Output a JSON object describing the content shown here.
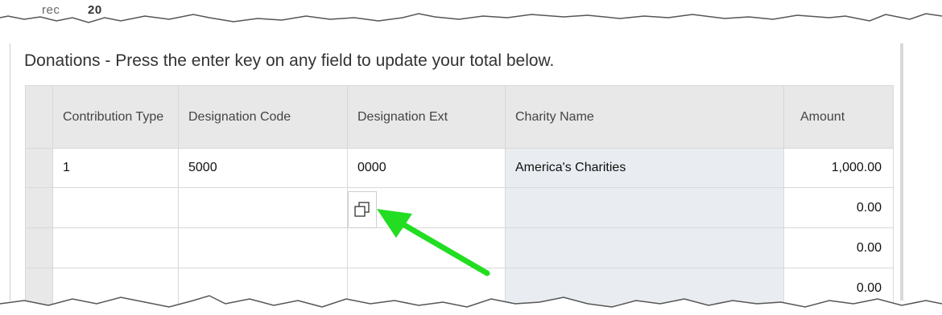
{
  "header": {
    "fragment_left": "rec",
    "fragment_year": "20"
  },
  "section": {
    "title": "Donations - Press the enter key on any field to update your total below."
  },
  "table": {
    "columns": [
      "Contribution Type",
      "Designation Code",
      "Designation Ext",
      "Charity Name",
      "Amount"
    ],
    "rows": [
      {
        "type": "1",
        "code": "5000",
        "ext": "0000",
        "charity": "America's Charities",
        "amount": "1,000.00"
      },
      {
        "type": "",
        "code": "",
        "ext": "",
        "charity": "",
        "amount": "0.00"
      },
      {
        "type": "",
        "code": "",
        "ext": "",
        "charity": "",
        "amount": "0.00"
      },
      {
        "type": "",
        "code": "",
        "ext": "",
        "charity": "",
        "amount": "0.00"
      }
    ]
  },
  "icons": {
    "lookup": "copy-icon",
    "arrow": "green-arrow-icon"
  },
  "colors": {
    "arrow": "#22dd22",
    "header_bg": "#e8e8e8",
    "charity_bg": "#e9edf1"
  }
}
